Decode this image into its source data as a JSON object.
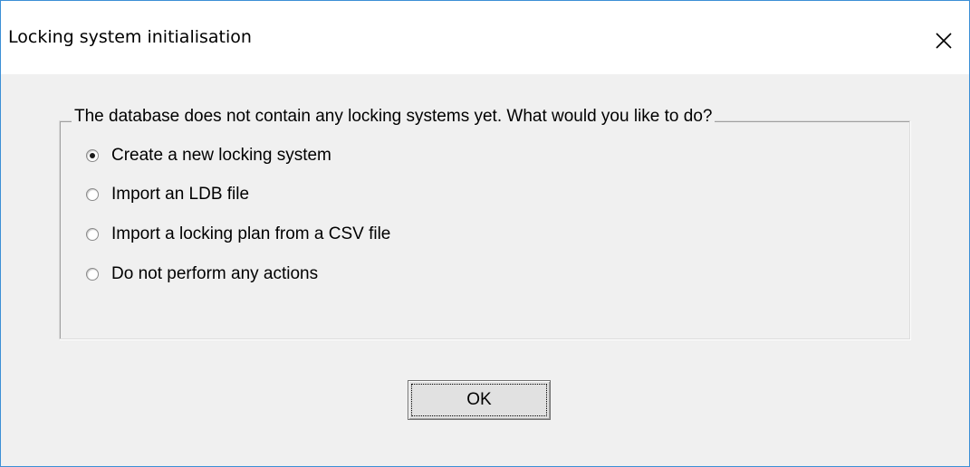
{
  "window": {
    "title": "Locking system initialisation",
    "close_icon": "close-icon"
  },
  "group": {
    "legend": "The database does not contain any locking systems yet. What would you like to do?",
    "options": [
      {
        "label": "Create a new locking system",
        "checked": true
      },
      {
        "label": "Import an LDB file",
        "checked": false
      },
      {
        "label": "Import a locking plan from a CSV file",
        "checked": false
      },
      {
        "label": "Do not perform any actions",
        "checked": false
      }
    ]
  },
  "buttons": {
    "ok_label": "OK"
  },
  "colors": {
    "window_border": "#3c8fd6",
    "dialog_background": "#f0f0f0",
    "titlebar_background": "#ffffff"
  }
}
